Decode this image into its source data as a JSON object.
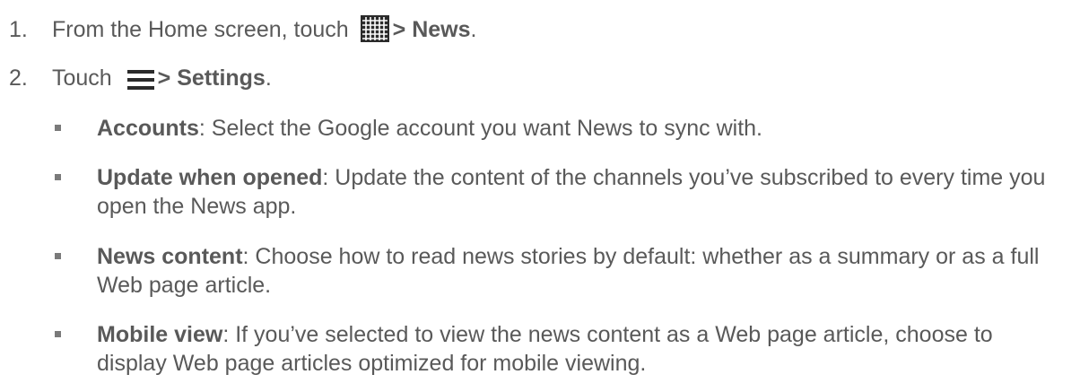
{
  "steps": [
    {
      "number": "1.",
      "prefix": "From the Home screen, touch",
      "icon": "apps-grid-icon",
      "action": "> News",
      "suffix": "."
    },
    {
      "number": "2.",
      "prefix": "Touch",
      "icon": "menu-icon",
      "action": "> Settings",
      "suffix": "."
    }
  ],
  "settings": [
    {
      "term": "Accounts",
      "description": ": Select the Google account you want News to sync with."
    },
    {
      "term": "Update when opened",
      "description": ": Update the content of the channels you’ve subscribed to every time you open the News app."
    },
    {
      "term": "News content",
      "description": ": Choose how to read news stories by default: whether as a summary or as a full Web page article."
    },
    {
      "term": "Mobile view",
      "description": ": If you’ve selected to view the news content as a Web page article, choose to display Web page articles optimized for mobile viewing."
    }
  ],
  "colors": {
    "text": "#595959",
    "icon": "#2b2b2b"
  }
}
